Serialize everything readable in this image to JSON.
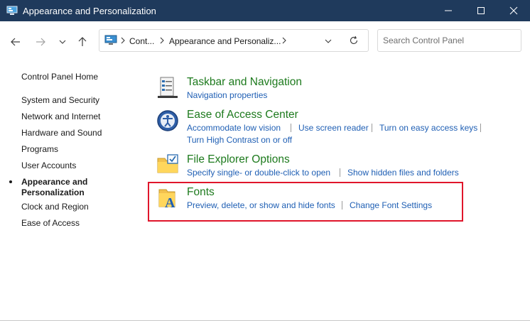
{
  "window": {
    "title": "Appearance and Personalization"
  },
  "address": {
    "crumbs": [
      "Cont...",
      "Appearance and Personaliz..."
    ]
  },
  "search": {
    "placeholder": "Search Control Panel"
  },
  "sidebar": {
    "home": "Control Panel Home",
    "items": [
      "System and Security",
      "Network and Internet",
      "Hardware and Sound",
      "Programs",
      "User Accounts",
      "Appearance and Personalization",
      "Clock and Region",
      "Ease of Access"
    ],
    "active_index": 5
  },
  "categories": [
    {
      "title": "Taskbar and Navigation",
      "icon": "taskbar-icon",
      "links": [
        "Navigation properties"
      ]
    },
    {
      "title": "Ease of Access Center",
      "icon": "ease-of-access-icon",
      "links": [
        "Accommodate low vision",
        "Use screen reader",
        "Turn on easy access keys",
        "Turn High Contrast on or off"
      ]
    },
    {
      "title": "File Explorer Options",
      "icon": "folder-options-icon",
      "links": [
        "Specify single- or double-click to open",
        "Show hidden files and folders"
      ]
    },
    {
      "title": "Fonts",
      "icon": "fonts-folder-icon",
      "links": [
        "Preview, delete, or show and hide fonts",
        "Change Font Settings"
      ]
    }
  ],
  "colors": {
    "titlebar": "#1f3a5c",
    "category_title": "#1d7a1d",
    "link": "#1f5fb4",
    "highlight": "#e0162b"
  }
}
